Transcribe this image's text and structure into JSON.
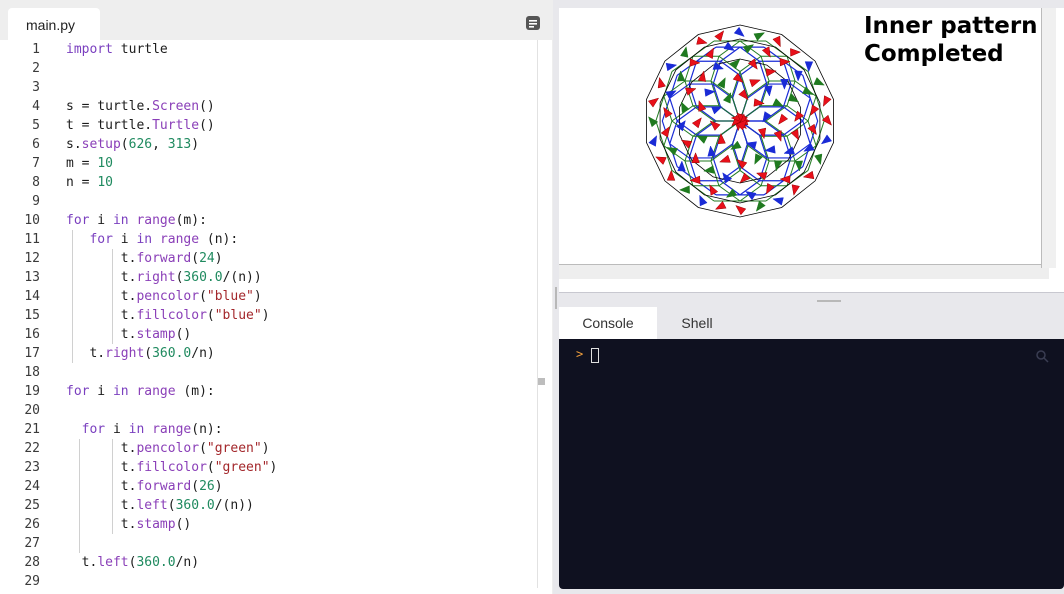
{
  "editor": {
    "file_tab": "main.py",
    "lines": [
      {
        "n": "1",
        "tokens": [
          [
            "kw",
            "import"
          ],
          [
            "def",
            " turtle"
          ]
        ]
      },
      {
        "n": "2",
        "tokens": []
      },
      {
        "n": "3",
        "tokens": []
      },
      {
        "n": "4",
        "tokens": [
          [
            "def",
            "s = turtle."
          ],
          [
            "fn",
            "Screen"
          ],
          [
            "def",
            "()"
          ]
        ]
      },
      {
        "n": "5",
        "tokens": [
          [
            "def",
            "t = turtle."
          ],
          [
            "fn",
            "Turtle"
          ],
          [
            "def",
            "()"
          ]
        ]
      },
      {
        "n": "6",
        "tokens": [
          [
            "def",
            "s."
          ],
          [
            "fn",
            "setup"
          ],
          [
            "def",
            "("
          ],
          [
            "num",
            "626"
          ],
          [
            "def",
            ", "
          ],
          [
            "num",
            "313"
          ],
          [
            "def",
            ")"
          ]
        ]
      },
      {
        "n": "7",
        "tokens": [
          [
            "def",
            "m = "
          ],
          [
            "num",
            "10"
          ]
        ]
      },
      {
        "n": "8",
        "tokens": [
          [
            "def",
            "n = "
          ],
          [
            "num",
            "10"
          ]
        ]
      },
      {
        "n": "9",
        "tokens": []
      },
      {
        "n": "10",
        "tokens": [
          [
            "kw",
            "for"
          ],
          [
            "def",
            " i "
          ],
          [
            "kw",
            "in"
          ],
          [
            "def",
            " "
          ],
          [
            "fn",
            "range"
          ],
          [
            "def",
            "(m):"
          ]
        ]
      },
      {
        "n": "11",
        "tokens": [
          [
            "def",
            "   "
          ],
          [
            "kw",
            "for"
          ],
          [
            "def",
            " i "
          ],
          [
            "kw",
            "in"
          ],
          [
            "def",
            " "
          ],
          [
            "fn",
            "range"
          ],
          [
            "def",
            " (n):"
          ]
        ]
      },
      {
        "n": "12",
        "tokens": [
          [
            "def",
            "       t."
          ],
          [
            "fn",
            "forward"
          ],
          [
            "def",
            "("
          ],
          [
            "num",
            "24"
          ],
          [
            "def",
            ")"
          ]
        ]
      },
      {
        "n": "13",
        "tokens": [
          [
            "def",
            "       t."
          ],
          [
            "fn",
            "right"
          ],
          [
            "def",
            "("
          ],
          [
            "num",
            "360.0"
          ],
          [
            "def",
            "/(n))"
          ]
        ]
      },
      {
        "n": "14",
        "tokens": [
          [
            "def",
            "       t."
          ],
          [
            "fn",
            "pencolor"
          ],
          [
            "def",
            "("
          ],
          [
            "str",
            "\"blue\""
          ],
          [
            "def",
            ")"
          ]
        ]
      },
      {
        "n": "15",
        "tokens": [
          [
            "def",
            "       t."
          ],
          [
            "fn",
            "fillcolor"
          ],
          [
            "def",
            "("
          ],
          [
            "str",
            "\"blue\""
          ],
          [
            "def",
            ")"
          ]
        ]
      },
      {
        "n": "16",
        "tokens": [
          [
            "def",
            "       t."
          ],
          [
            "fn",
            "stamp"
          ],
          [
            "def",
            "()"
          ]
        ]
      },
      {
        "n": "17",
        "tokens": [
          [
            "def",
            "   t."
          ],
          [
            "fn",
            "right"
          ],
          [
            "def",
            "("
          ],
          [
            "num",
            "360.0"
          ],
          [
            "def",
            "/n)"
          ]
        ]
      },
      {
        "n": "18",
        "tokens": []
      },
      {
        "n": "19",
        "tokens": [
          [
            "kw",
            "for"
          ],
          [
            "def",
            " i "
          ],
          [
            "kw",
            "in"
          ],
          [
            "def",
            " "
          ],
          [
            "fn",
            "range"
          ],
          [
            "def",
            " (m):"
          ]
        ]
      },
      {
        "n": "20",
        "tokens": []
      },
      {
        "n": "21",
        "tokens": [
          [
            "def",
            "  "
          ],
          [
            "kw",
            "for"
          ],
          [
            "def",
            " i "
          ],
          [
            "kw",
            "in"
          ],
          [
            "def",
            " "
          ],
          [
            "fn",
            "range"
          ],
          [
            "def",
            "(n):"
          ]
        ]
      },
      {
        "n": "22",
        "tokens": [
          [
            "def",
            "       t."
          ],
          [
            "fn",
            "pencolor"
          ],
          [
            "def",
            "("
          ],
          [
            "str",
            "\"green\""
          ],
          [
            "def",
            ")"
          ]
        ]
      },
      {
        "n": "23",
        "tokens": [
          [
            "def",
            "       t."
          ],
          [
            "fn",
            "fillcolor"
          ],
          [
            "def",
            "("
          ],
          [
            "str",
            "\"green\""
          ],
          [
            "def",
            ")"
          ]
        ]
      },
      {
        "n": "24",
        "tokens": [
          [
            "def",
            "       t."
          ],
          [
            "fn",
            "forward"
          ],
          [
            "def",
            "("
          ],
          [
            "num",
            "26"
          ],
          [
            "def",
            ")"
          ]
        ]
      },
      {
        "n": "25",
        "tokens": [
          [
            "def",
            "       t."
          ],
          [
            "fn",
            "left"
          ],
          [
            "def",
            "("
          ],
          [
            "num",
            "360.0"
          ],
          [
            "def",
            "/(n))"
          ]
        ]
      },
      {
        "n": "26",
        "tokens": [
          [
            "def",
            "       t."
          ],
          [
            "fn",
            "stamp"
          ],
          [
            "def",
            "()"
          ]
        ]
      },
      {
        "n": "27",
        "tokens": []
      },
      {
        "n": "28",
        "tokens": [
          [
            "def",
            "  t."
          ],
          [
            "fn",
            "left"
          ],
          [
            "def",
            "("
          ],
          [
            "num",
            "360.0"
          ],
          [
            "def",
            "/n)"
          ]
        ]
      },
      {
        "n": "29",
        "tokens": []
      }
    ]
  },
  "output": {
    "status_line1": "Inner pattern",
    "status_line2": "Completed",
    "drawing": {
      "m": 10,
      "n": 10,
      "colors": {
        "blue": "#1a2bd6",
        "green": "#1f7a1f",
        "red": "#e8101a",
        "outline": "#000000"
      }
    }
  },
  "console": {
    "tab_console": "Console",
    "tab_shell": "Shell",
    "prompt": ">"
  },
  "colors": {
    "terminal_bg": "#0f1120",
    "prompt": "#f2a03d",
    "keyword": "#7a3fbf",
    "number": "#1f8a5f",
    "string": "#a3272b"
  }
}
